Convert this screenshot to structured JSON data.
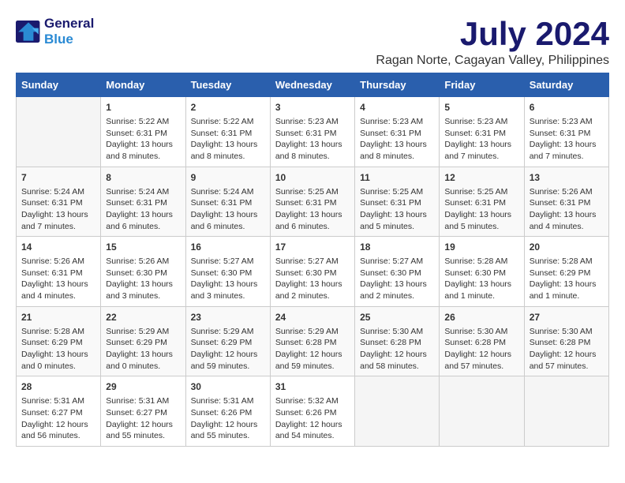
{
  "header": {
    "logo_line1": "General",
    "logo_line2": "Blue",
    "month": "July 2024",
    "location": "Ragan Norte, Cagayan Valley, Philippines"
  },
  "days_of_week": [
    "Sunday",
    "Monday",
    "Tuesday",
    "Wednesday",
    "Thursday",
    "Friday",
    "Saturday"
  ],
  "weeks": [
    [
      {
        "day": "",
        "info": ""
      },
      {
        "day": "1",
        "info": "Sunrise: 5:22 AM\nSunset: 6:31 PM\nDaylight: 13 hours\nand 8 minutes."
      },
      {
        "day": "2",
        "info": "Sunrise: 5:22 AM\nSunset: 6:31 PM\nDaylight: 13 hours\nand 8 minutes."
      },
      {
        "day": "3",
        "info": "Sunrise: 5:23 AM\nSunset: 6:31 PM\nDaylight: 13 hours\nand 8 minutes."
      },
      {
        "day": "4",
        "info": "Sunrise: 5:23 AM\nSunset: 6:31 PM\nDaylight: 13 hours\nand 8 minutes."
      },
      {
        "day": "5",
        "info": "Sunrise: 5:23 AM\nSunset: 6:31 PM\nDaylight: 13 hours\nand 7 minutes."
      },
      {
        "day": "6",
        "info": "Sunrise: 5:23 AM\nSunset: 6:31 PM\nDaylight: 13 hours\nand 7 minutes."
      }
    ],
    [
      {
        "day": "7",
        "info": "Sunrise: 5:24 AM\nSunset: 6:31 PM\nDaylight: 13 hours\nand 7 minutes."
      },
      {
        "day": "8",
        "info": "Sunrise: 5:24 AM\nSunset: 6:31 PM\nDaylight: 13 hours\nand 6 minutes."
      },
      {
        "day": "9",
        "info": "Sunrise: 5:24 AM\nSunset: 6:31 PM\nDaylight: 13 hours\nand 6 minutes."
      },
      {
        "day": "10",
        "info": "Sunrise: 5:25 AM\nSunset: 6:31 PM\nDaylight: 13 hours\nand 6 minutes."
      },
      {
        "day": "11",
        "info": "Sunrise: 5:25 AM\nSunset: 6:31 PM\nDaylight: 13 hours\nand 5 minutes."
      },
      {
        "day": "12",
        "info": "Sunrise: 5:25 AM\nSunset: 6:31 PM\nDaylight: 13 hours\nand 5 minutes."
      },
      {
        "day": "13",
        "info": "Sunrise: 5:26 AM\nSunset: 6:31 PM\nDaylight: 13 hours\nand 4 minutes."
      }
    ],
    [
      {
        "day": "14",
        "info": "Sunrise: 5:26 AM\nSunset: 6:31 PM\nDaylight: 13 hours\nand 4 minutes."
      },
      {
        "day": "15",
        "info": "Sunrise: 5:26 AM\nSunset: 6:30 PM\nDaylight: 13 hours\nand 3 minutes."
      },
      {
        "day": "16",
        "info": "Sunrise: 5:27 AM\nSunset: 6:30 PM\nDaylight: 13 hours\nand 3 minutes."
      },
      {
        "day": "17",
        "info": "Sunrise: 5:27 AM\nSunset: 6:30 PM\nDaylight: 13 hours\nand 2 minutes."
      },
      {
        "day": "18",
        "info": "Sunrise: 5:27 AM\nSunset: 6:30 PM\nDaylight: 13 hours\nand 2 minutes."
      },
      {
        "day": "19",
        "info": "Sunrise: 5:28 AM\nSunset: 6:30 PM\nDaylight: 13 hours\nand 1 minute."
      },
      {
        "day": "20",
        "info": "Sunrise: 5:28 AM\nSunset: 6:29 PM\nDaylight: 13 hours\nand 1 minute."
      }
    ],
    [
      {
        "day": "21",
        "info": "Sunrise: 5:28 AM\nSunset: 6:29 PM\nDaylight: 13 hours\nand 0 minutes."
      },
      {
        "day": "22",
        "info": "Sunrise: 5:29 AM\nSunset: 6:29 PM\nDaylight: 13 hours\nand 0 minutes."
      },
      {
        "day": "23",
        "info": "Sunrise: 5:29 AM\nSunset: 6:29 PM\nDaylight: 12 hours\nand 59 minutes."
      },
      {
        "day": "24",
        "info": "Sunrise: 5:29 AM\nSunset: 6:28 PM\nDaylight: 12 hours\nand 59 minutes."
      },
      {
        "day": "25",
        "info": "Sunrise: 5:30 AM\nSunset: 6:28 PM\nDaylight: 12 hours\nand 58 minutes."
      },
      {
        "day": "26",
        "info": "Sunrise: 5:30 AM\nSunset: 6:28 PM\nDaylight: 12 hours\nand 57 minutes."
      },
      {
        "day": "27",
        "info": "Sunrise: 5:30 AM\nSunset: 6:28 PM\nDaylight: 12 hours\nand 57 minutes."
      }
    ],
    [
      {
        "day": "28",
        "info": "Sunrise: 5:31 AM\nSunset: 6:27 PM\nDaylight: 12 hours\nand 56 minutes."
      },
      {
        "day": "29",
        "info": "Sunrise: 5:31 AM\nSunset: 6:27 PM\nDaylight: 12 hours\nand 55 minutes."
      },
      {
        "day": "30",
        "info": "Sunrise: 5:31 AM\nSunset: 6:26 PM\nDaylight: 12 hours\nand 55 minutes."
      },
      {
        "day": "31",
        "info": "Sunrise: 5:32 AM\nSunset: 6:26 PM\nDaylight: 12 hours\nand 54 minutes."
      },
      {
        "day": "",
        "info": ""
      },
      {
        "day": "",
        "info": ""
      },
      {
        "day": "",
        "info": ""
      }
    ]
  ]
}
